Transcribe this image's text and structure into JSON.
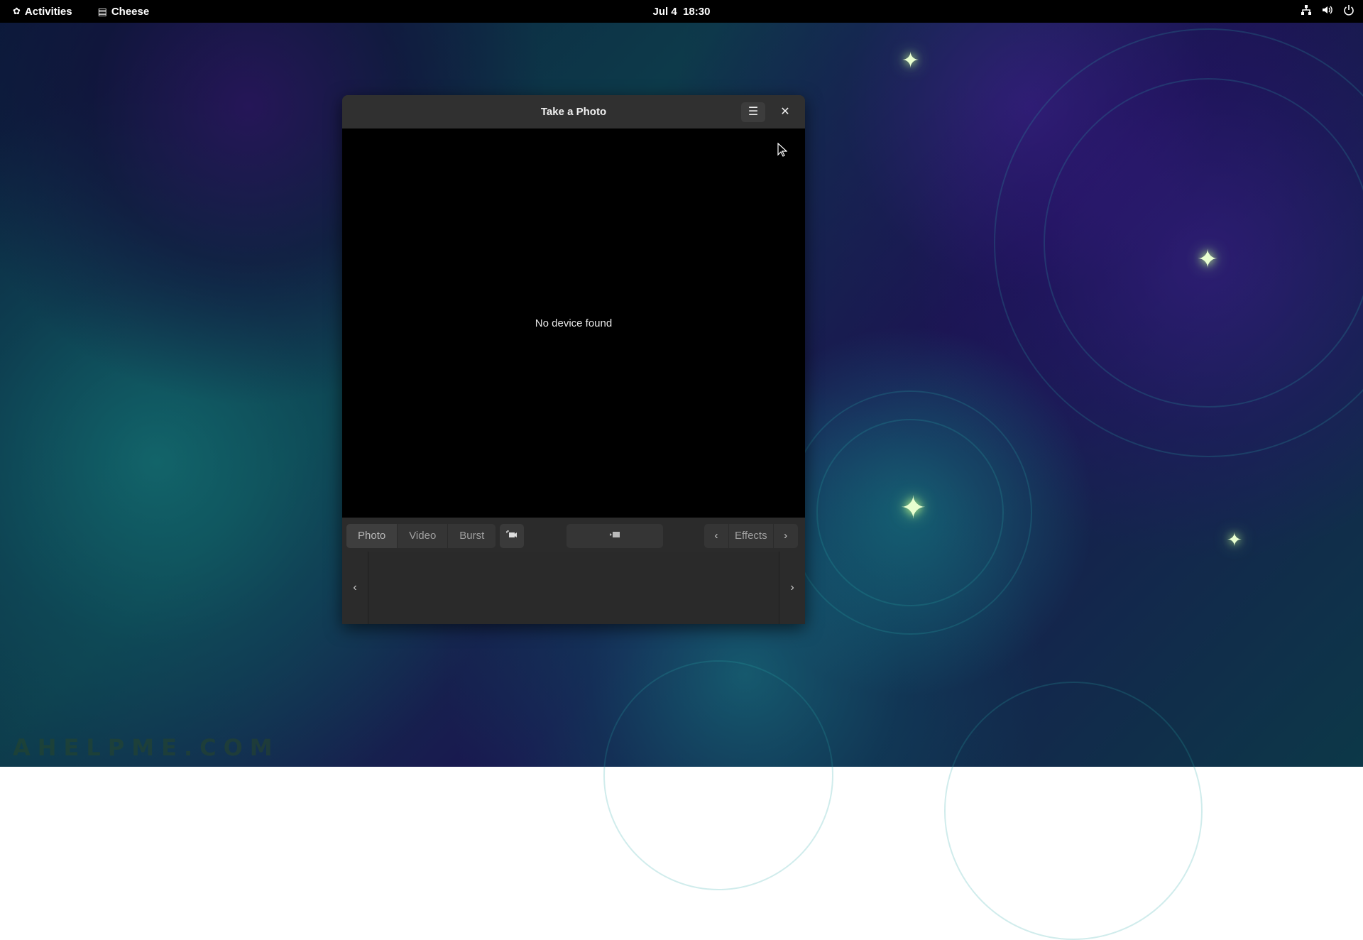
{
  "topbar": {
    "activities_label": "Activities",
    "app_name": "Cheese",
    "clock_date": "Jul 4",
    "clock_time": "18:30",
    "icons": [
      "network-icon",
      "volume-icon",
      "power-icon"
    ]
  },
  "window": {
    "title": "Take a Photo",
    "status_message": "No device found",
    "modes": [
      "Photo",
      "Video",
      "Burst"
    ],
    "active_mode": "Photo",
    "effects_label": "Effects"
  },
  "watermark": "AHELPME.COM",
  "colors": {
    "topbar_bg": "#000000",
    "window_bg": "#2b2b2b",
    "viewport_bg": "#000000"
  }
}
